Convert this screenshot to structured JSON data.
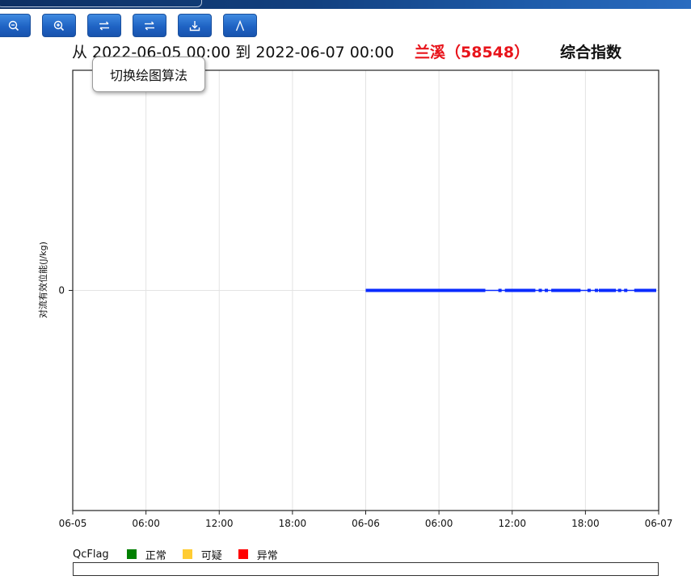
{
  "toolbar": {
    "buttons": [
      {
        "icon": "zoom-out-icon"
      },
      {
        "icon": "zoom-in-icon"
      },
      {
        "icon": "swap-arrows-icon"
      },
      {
        "icon": "swap-arrows-icon"
      },
      {
        "icon": "download-icon"
      },
      {
        "icon": "font-a-icon"
      }
    ]
  },
  "header": {
    "range_text": "从 2022-06-05 00:00 到 2022-06-07 00:00",
    "station": "兰溪（58548）",
    "element": "综合指数"
  },
  "tooltip": {
    "text": "切换绘图算法"
  },
  "chart_data": {
    "type": "line",
    "ylabel": "对流有效位能(J/kg)",
    "y_ticks": [
      0
    ],
    "ylim": [
      -1,
      1
    ],
    "x_ticks": [
      "06-05",
      "06:00",
      "12:00",
      "18:00",
      "06-06",
      "06:00",
      "12:00",
      "18:00",
      "06-07"
    ],
    "x_range_hours": [
      0,
      48
    ],
    "grid": true,
    "series": [
      {
        "color": "#0a2bff",
        "value": 0,
        "segments_hours": [
          [
            24.0,
            33.8
          ],
          [
            35.4,
            37.9
          ],
          [
            39.2,
            41.6
          ],
          [
            43.1,
            44.5
          ],
          [
            46.0,
            47.8
          ]
        ],
        "points_hours": [
          35.0,
          36.3,
          37.2,
          38.3,
          38.8,
          42.3,
          42.9,
          44.8,
          45.3
        ]
      }
    ]
  },
  "legend": {
    "title": "QcFlag",
    "items": [
      {
        "label": "正常",
        "color": "#008000"
      },
      {
        "label": "可疑",
        "color": "#ffcc33"
      },
      {
        "label": "异常",
        "color": "#ff0000"
      }
    ]
  }
}
